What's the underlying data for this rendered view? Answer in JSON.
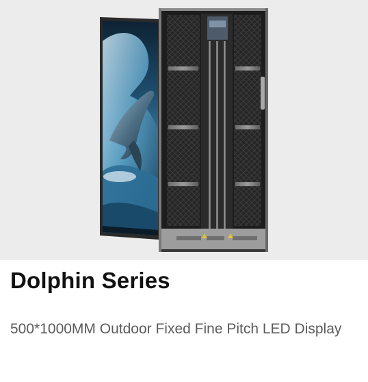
{
  "product": {
    "title": "Dolphin Series",
    "description": "500*1000MM Outdoor Fixed Fine Pitch LED Display",
    "image": {
      "icon": "led-panel-product-image",
      "background_color": "#ececec"
    }
  }
}
